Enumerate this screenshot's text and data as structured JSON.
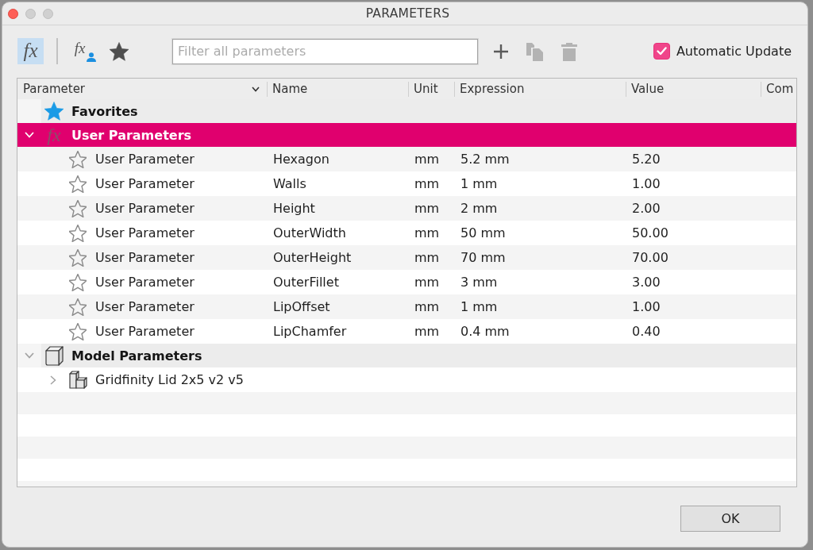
{
  "window": {
    "title": "PARAMETERS"
  },
  "toolbar": {
    "view_buttons": [
      {
        "kind": "glyph",
        "glyph": "fx",
        "selected": true
      },
      {
        "kind": "glyph-person",
        "glyph": "fx",
        "selected": false
      },
      {
        "kind": "star",
        "selected": false
      }
    ],
    "filter": {
      "placeholder": "Filter all parameters"
    },
    "actions": [
      {
        "kind": "plus",
        "disabled": false
      },
      {
        "kind": "copy",
        "disabled": true
      },
      {
        "kind": "trash",
        "disabled": true
      }
    ],
    "automatic_update": {
      "label": "Automatic Update",
      "checked": true
    }
  },
  "table": {
    "columns": [
      {
        "label": "Parameter",
        "menu": true
      },
      {
        "label": "Name",
        "menu": false
      },
      {
        "label": "Unit",
        "menu": false
      },
      {
        "label": "Expression",
        "menu": false
      },
      {
        "label": "Value",
        "menu": false
      },
      {
        "label": "Com",
        "menu": false
      }
    ],
    "tree": [
      {
        "kind": "favorites",
        "label": "Favorites",
        "selected": false
      },
      {
        "kind": "user",
        "glyph": "fx",
        "label": "User Parameters",
        "expanded": true,
        "selected": true,
        "children": [
          {
            "kind": "parameter",
            "parameter": "User Parameter",
            "name": "Hexagon",
            "unit": "mm",
            "expression": "5.2 mm",
            "value": "5.20",
            "favorite": false,
            "selected": false
          },
          {
            "kind": "parameter",
            "parameter": "User Parameter",
            "name": "Walls",
            "unit": "mm",
            "expression": "1 mm",
            "value": "1.00",
            "favorite": false,
            "selected": false
          },
          {
            "kind": "parameter",
            "parameter": "User Parameter",
            "name": "Height",
            "unit": "mm",
            "expression": "2 mm",
            "value": "2.00",
            "favorite": false,
            "selected": false
          },
          {
            "kind": "parameter",
            "parameter": "User Parameter",
            "name": "OuterWidth",
            "unit": "mm",
            "expression": "50 mm",
            "value": "50.00",
            "favorite": false,
            "selected": false
          },
          {
            "kind": "parameter",
            "parameter": "User Parameter",
            "name": "OuterHeight",
            "unit": "mm",
            "expression": "70 mm",
            "value": "70.00",
            "favorite": false,
            "selected": false
          },
          {
            "kind": "parameter",
            "parameter": "User Parameter",
            "name": "OuterFillet",
            "unit": "mm",
            "expression": "3 mm",
            "value": "3.00",
            "favorite": false,
            "selected": false
          },
          {
            "kind": "parameter",
            "parameter": "User Parameter",
            "name": "LipOffset",
            "unit": "mm",
            "expression": "1 mm",
            "value": "1.00",
            "favorite": false,
            "selected": false
          },
          {
            "kind": "parameter",
            "parameter": "User Parameter",
            "name": "LipChamfer",
            "unit": "mm",
            "expression": "0.4 mm",
            "value": "0.40",
            "favorite": false,
            "selected": false
          }
        ]
      },
      {
        "kind": "model",
        "label": "Model Parameters",
        "expanded": true,
        "selected": false,
        "children": [
          {
            "kind": "component",
            "label": "Gridfinity Lid 2x5 v2 v5",
            "expanded": false,
            "selected": false
          }
        ]
      }
    ]
  },
  "buttons": [
    "OK"
  ]
}
